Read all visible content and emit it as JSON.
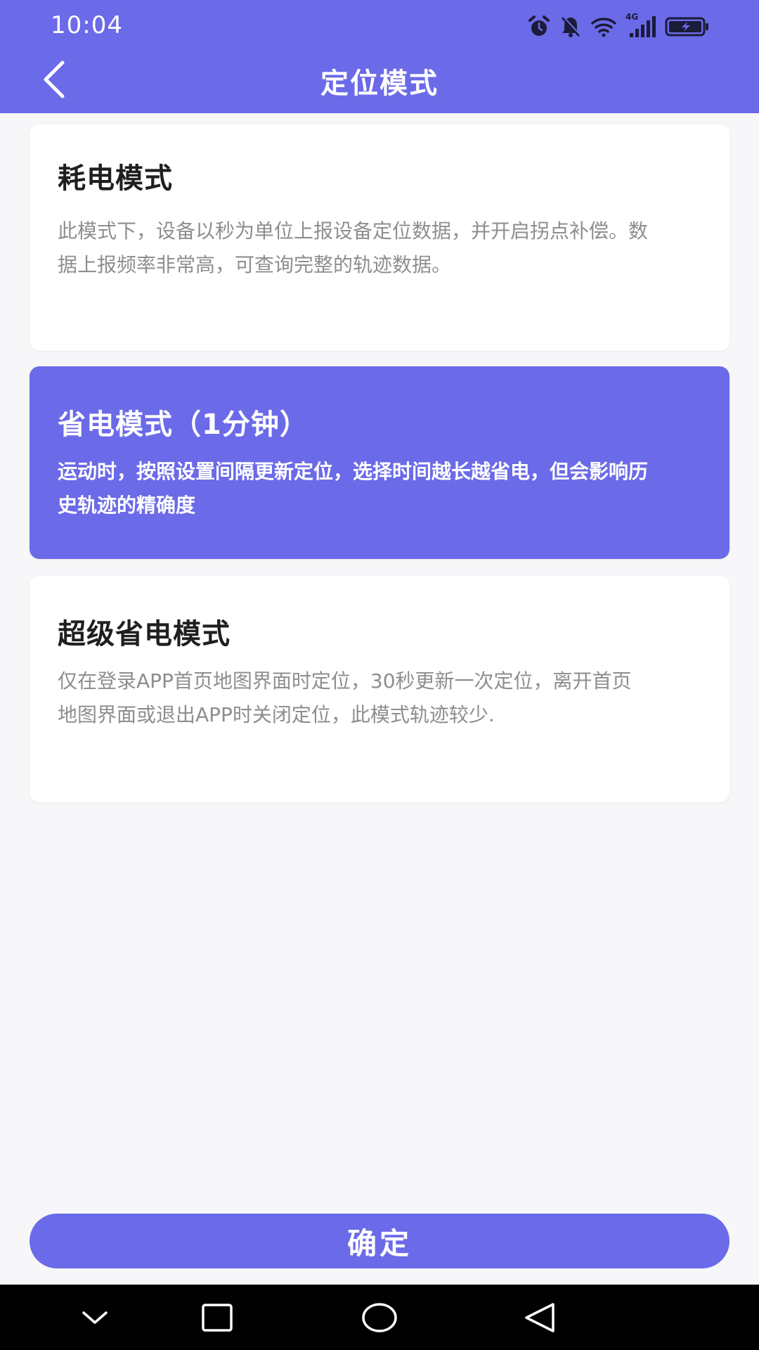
{
  "status_bar": {
    "time": "10:04",
    "network_label": "4G"
  },
  "app_bar": {
    "title": "定位模式"
  },
  "modes": [
    {
      "title": "耗电模式",
      "description": "此模式下，设备以秒为单位上报设备定位数据，并开启拐点补偿。数据上报频率非常高，可查询完整的轨迹数据。",
      "selected": false
    },
    {
      "title": "省电模式（1分钟）",
      "description": "运动时，按照设置间隔更新定位，选择时间越长越省电，但会影响历史轨迹的精确度",
      "selected": true
    },
    {
      "title": "超级省电模式",
      "description": "仅在登录APP首页地图界面时定位，30秒更新一次定位，离开首页地图界面或退出APP时关闭定位，此模式轨迹较少.",
      "selected": false
    }
  ],
  "confirm_label": "确定",
  "colors": {
    "accent": "#6b6ae8",
    "background": "#f7f7f9",
    "card": "#ffffff",
    "title_text": "#1f1f1f",
    "desc_text": "#8e8e8e",
    "nav_bar": "#000000"
  },
  "icons": {
    "status": [
      "alarm-icon",
      "mute-bell-icon",
      "wifi-icon",
      "signal-icon",
      "battery-charging-icon"
    ],
    "app_bar": [
      "back-arrow-icon"
    ],
    "nav": [
      "nav-down-icon",
      "nav-recents-icon",
      "nav-home-icon",
      "nav-back-icon"
    ]
  }
}
